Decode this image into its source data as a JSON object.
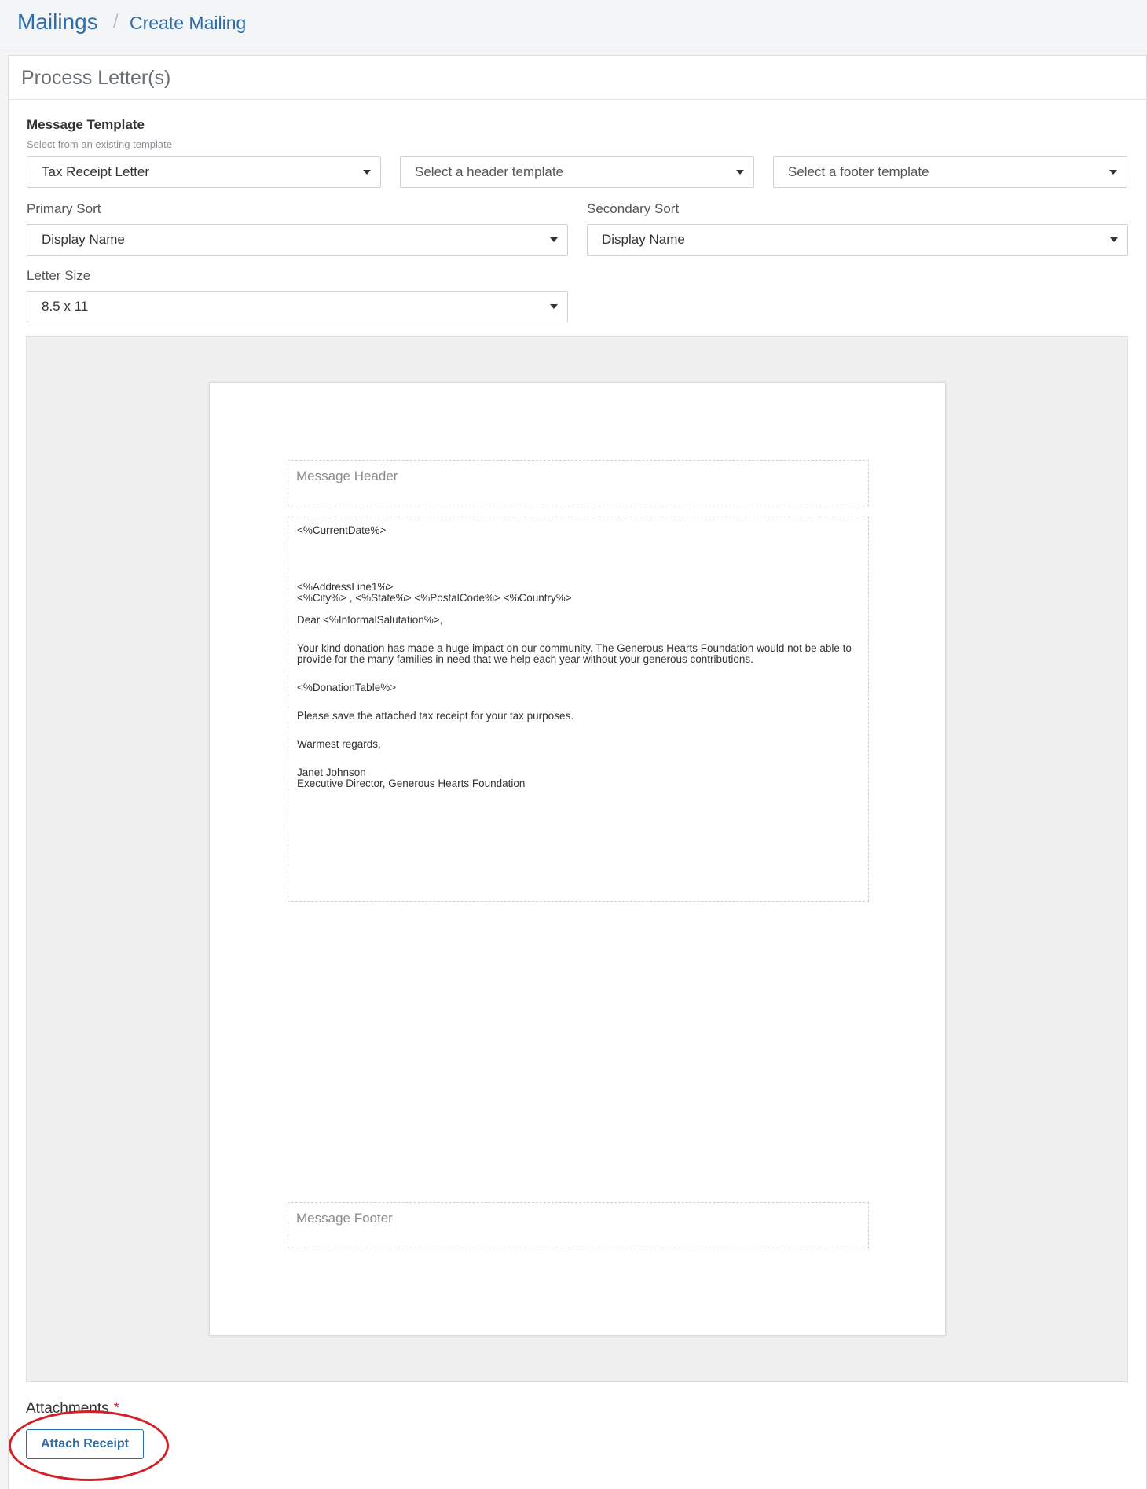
{
  "breadcrumb": {
    "root": "Mailings",
    "separator": "/",
    "current": "Create Mailing"
  },
  "card": {
    "title": "Process Letter(s)"
  },
  "form": {
    "message_template": {
      "label": "Message Template",
      "helper": "Select from an existing template",
      "value": "Tax Receipt Letter",
      "header_placeholder": "Select a header template",
      "footer_placeholder": "Select a footer template"
    },
    "primary_sort": {
      "label": "Primary Sort",
      "value": "Display Name"
    },
    "secondary_sort": {
      "label": "Secondary Sort",
      "value": "Display Name"
    },
    "letter_size": {
      "label": "Letter Size",
      "value": "8.5 x 11"
    }
  },
  "letter": {
    "header_placeholder": "Message Header",
    "footer_placeholder": "Message Footer",
    "current_date": "<%CurrentDate%>",
    "address_line1": "<%AddressLine1%>",
    "address_line2": "<%City%> , <%State%>  <%PostalCode%>  <%Country%>",
    "greeting": "Dear <%InformalSalutation%>,",
    "paragraph1": "Your kind donation has made a huge impact on our community. The Generous Hearts Foundation would not be able to provide for the many families in need that we help each year without your generous contributions.",
    "donation_table": "<%DonationTable%>",
    "paragraph2": "Please save the attached tax receipt for your tax purposes.",
    "closing": "Warmest regards,",
    "signature_name": "Janet Johnson",
    "signature_title": "Executive Director, Generous Hearts Foundation"
  },
  "attachments": {
    "label": "Attachments",
    "required_marker": "*",
    "button_label": "Attach Receipt"
  },
  "colors": {
    "brand_blue": "#2f6da6",
    "highlight_red": "#d41f26"
  }
}
